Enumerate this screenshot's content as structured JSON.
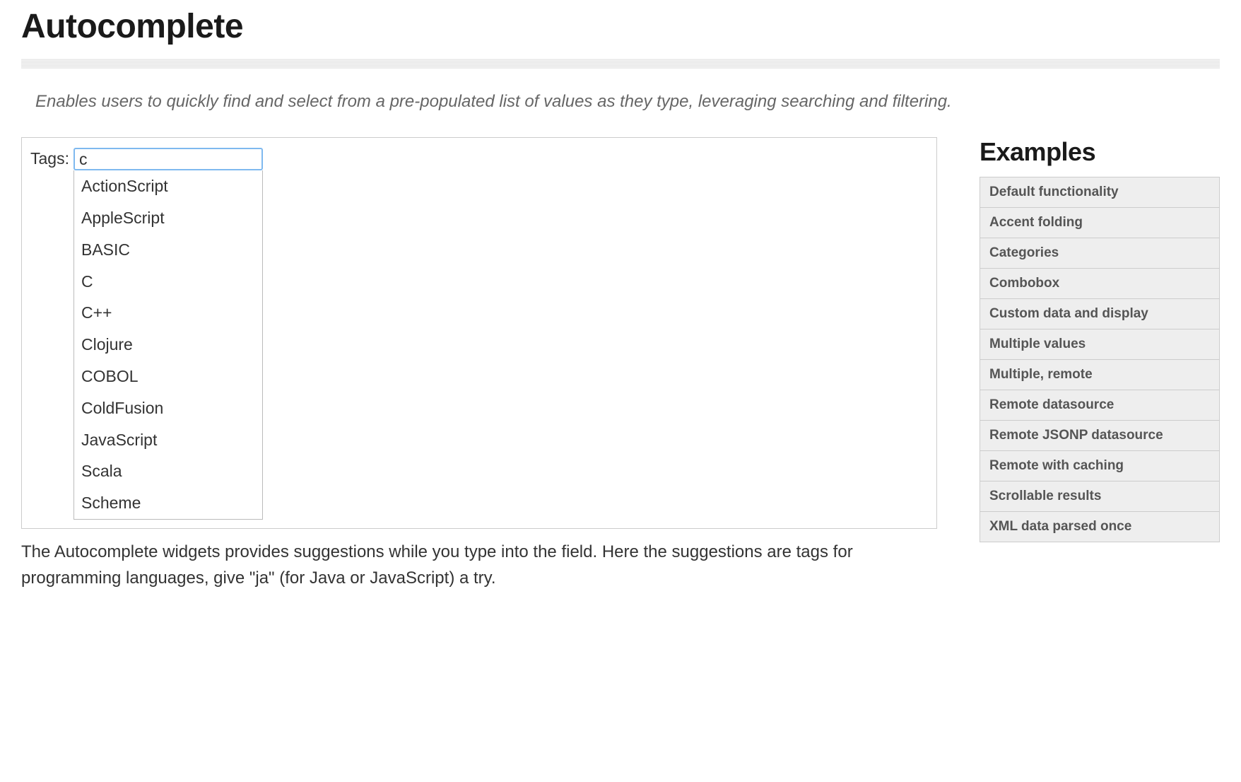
{
  "page": {
    "title": "Autocomplete",
    "description": "Enables users to quickly find and select from a pre-populated list of values as they type, leveraging searching and filtering.",
    "afterText": "The Autocomplete widgets provides suggestions while you type into the field. Here the suggestions are tags for programming languages, give \"ja\" (for Java or JavaScript) a try."
  },
  "demo": {
    "fieldLabel": "Tags:",
    "inputValue": "c",
    "suggestions": [
      "ActionScript",
      "AppleScript",
      "BASIC",
      "C",
      "C++",
      "Clojure",
      "COBOL",
      "ColdFusion",
      "JavaScript",
      "Scala",
      "Scheme"
    ]
  },
  "sidebar": {
    "title": "Examples",
    "items": [
      {
        "label": "Default functionality"
      },
      {
        "label": "Accent folding"
      },
      {
        "label": "Categories"
      },
      {
        "label": "Combobox"
      },
      {
        "label": "Custom data and display"
      },
      {
        "label": "Multiple values"
      },
      {
        "label": "Multiple, remote"
      },
      {
        "label": "Remote datasource"
      },
      {
        "label": "Remote JSONP datasource"
      },
      {
        "label": "Remote with caching"
      },
      {
        "label": "Scrollable results"
      },
      {
        "label": "XML data parsed once"
      }
    ]
  }
}
